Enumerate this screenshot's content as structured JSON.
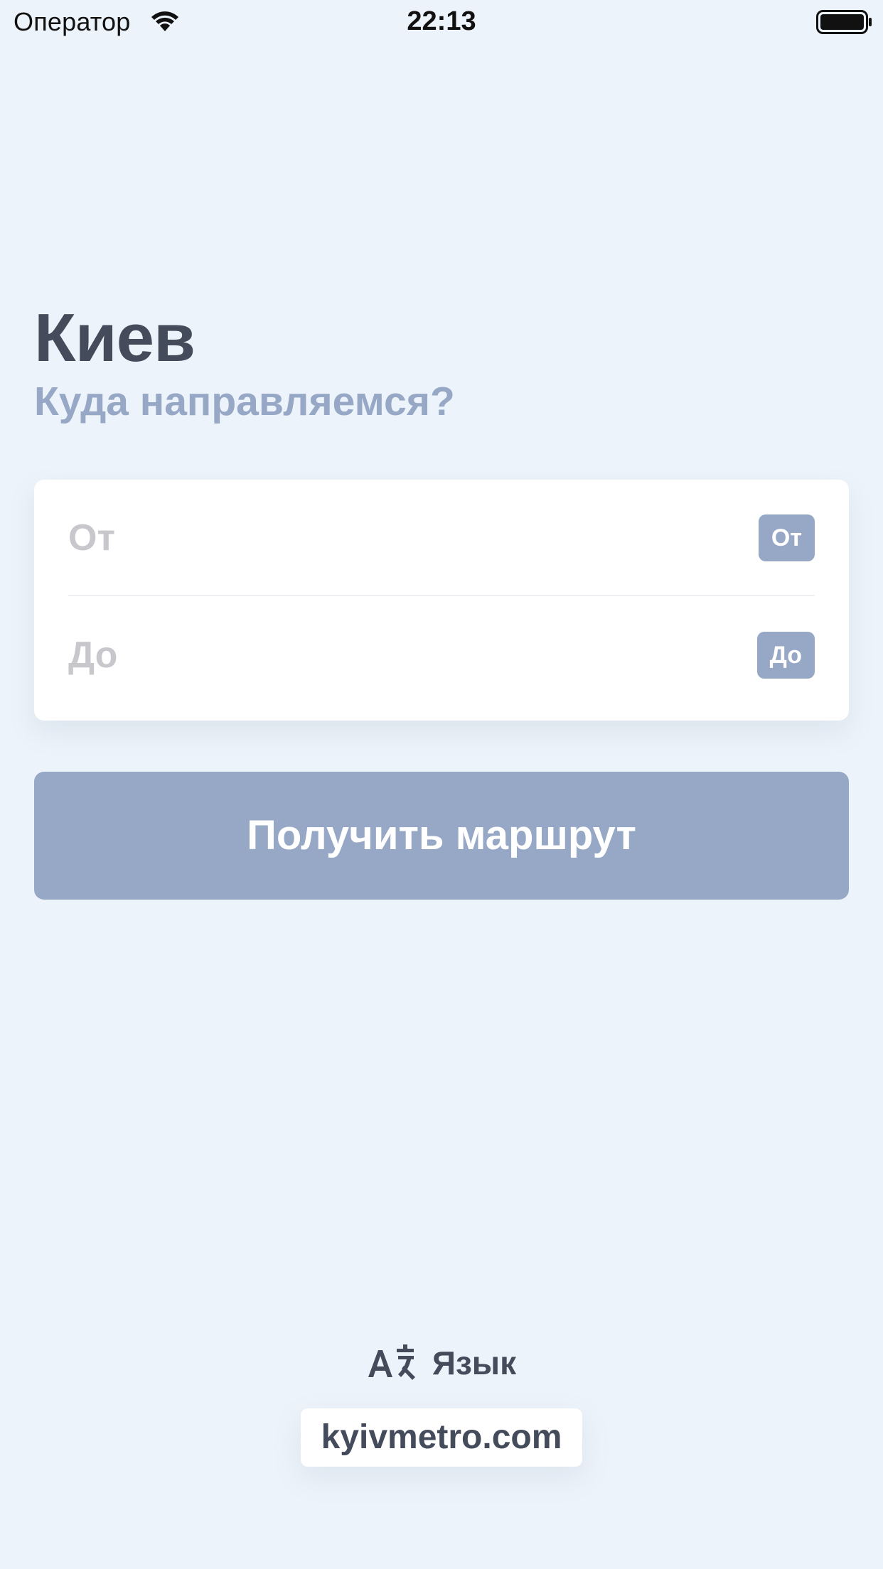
{
  "status_bar": {
    "carrier": "Оператор",
    "time": "22:13"
  },
  "header": {
    "city": "Киев",
    "subtitle": "Куда направляемся?"
  },
  "route_form": {
    "from_placeholder": "От",
    "from_value": "",
    "from_badge": "От",
    "to_placeholder": "До",
    "to_value": "",
    "to_badge": "До"
  },
  "actions": {
    "get_route_label": "Получить маршрут"
  },
  "footer": {
    "language_label": "Язык",
    "site_label": "kyivmetro.com"
  },
  "colors": {
    "background": "#edf3fa",
    "accent": "#96a8c5",
    "text_dark": "#444b5b",
    "placeholder": "#c7c7cc"
  }
}
